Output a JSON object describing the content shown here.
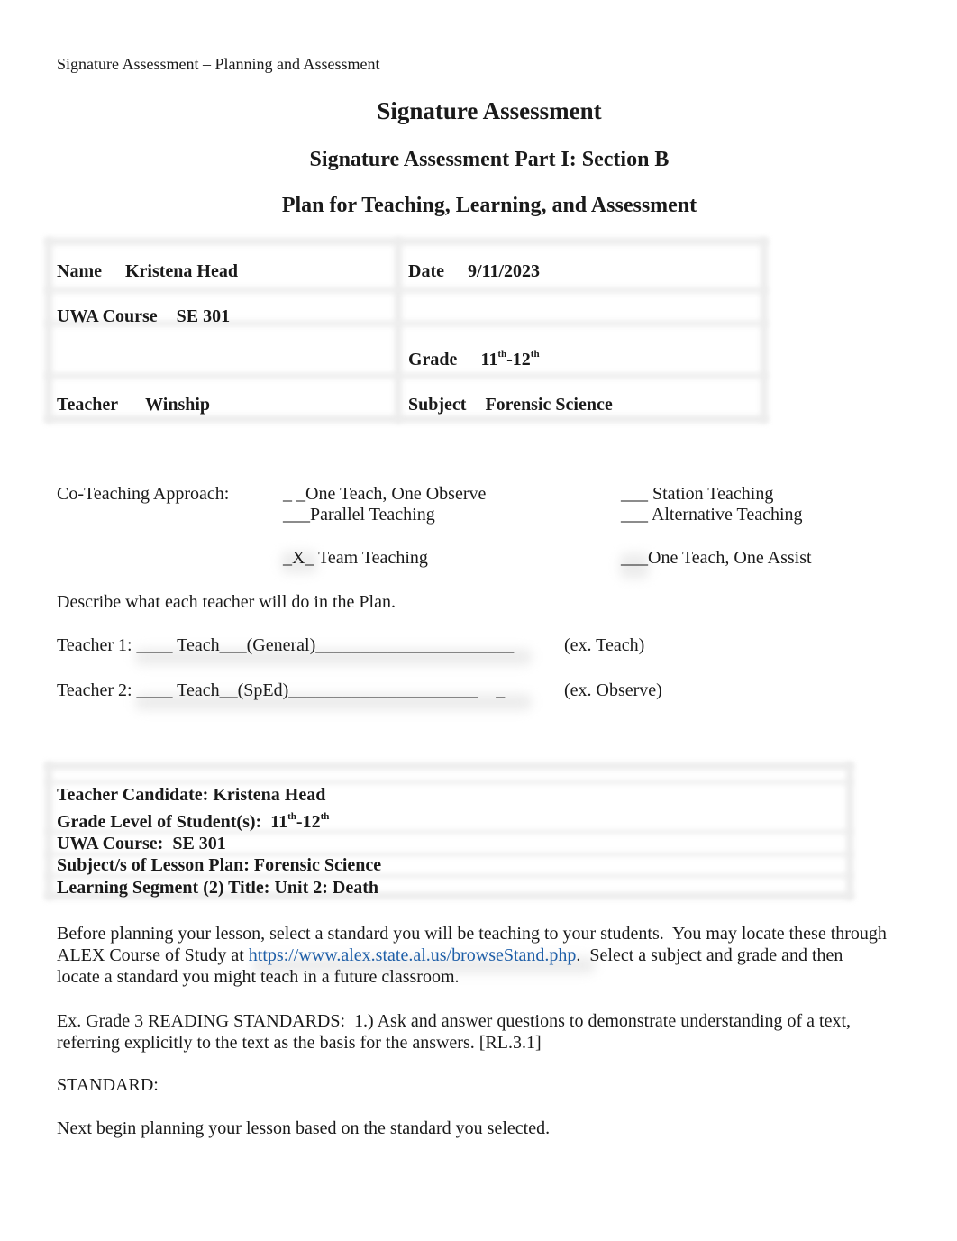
{
  "running_header": "Signature Assessment – Planning and Assessment",
  "titles": {
    "main": "Signature Assessment",
    "part": "Signature Assessment Part I: Section B",
    "plan": "Plan for Teaching, Learning, and Assessment"
  },
  "info_table": {
    "name_label": "Name",
    "name_value": "Kristena Head",
    "date_label": "Date",
    "date_value": "9/11/2023",
    "course_label": "UWA Course",
    "course_value": "SE 301",
    "grade_label": "Grade",
    "grade_from": "11",
    "grade_to": "12",
    "ordinal_suffix": "th",
    "grade_sep": "-",
    "teacher_label": "Teacher",
    "teacher_value": "Winship",
    "subject_label": "Subject",
    "subject_value": "Forensic Science"
  },
  "co_teaching": {
    "label": "Co-Teaching Approach:",
    "options": [
      {
        "mark": "_ _",
        "label": "One Teach, One Observe"
      },
      {
        "mark": "___",
        "label": "Parallel Teaching"
      },
      {
        "mark": "_X_ ",
        "label": "Team Teaching"
      },
      {
        "mark": "___ ",
        "label": "Station Teaching"
      },
      {
        "mark": "___ ",
        "label": "Alternative Teaching"
      },
      {
        "mark": "___",
        "label": "One Teach, One Assist"
      }
    ],
    "selected": "Team Teaching"
  },
  "describe_prompt": "Describe what each teacher will do in the Plan.",
  "teachers": [
    {
      "label": "Teacher 1:",
      "line": "____ Teach___(General)______________________",
      "example": "(ex. Teach)"
    },
    {
      "label": "Teacher 2:",
      "line": "____ Teach__(SpEd)_____________________    _",
      "example": "(ex. Observe)"
    }
  ],
  "candidate_box": {
    "candidate": "Teacher Candidate:  Kristena Head",
    "grade_level_label": "Grade Level of Student(s):  ",
    "grade_from": "11",
    "grade_to": "12",
    "ordinal_suffix": "th",
    "grade_sep": "-",
    "course": "UWA Course:  SE 301",
    "subjects": "Subject/s of Lesson Plan: Forensic Science",
    "segment": "Learning Segment (2) Title: Unit 2: Death"
  },
  "instructions": {
    "line1": "Before planning your lesson, select a standard you will be teaching to your students.  You may locate these through",
    "line2_pre": "ALEX Course of Study at ",
    "link": "https://www.alex.state.al.us/browseStand.php",
    "line2_post": ".  Select a subject and grade and then",
    "line3": "locate a standard you might teach in a future classroom."
  },
  "example_standard": {
    "line1": "Ex. Grade 3 READING STANDARDS:  1.) Ask and answer questions to demonstrate understanding of a text,",
    "line2": "referring explicitly to the text as the basis for the answers. [RL.3.1]"
  },
  "standard_label": "STANDARD:",
  "next_step": "Next begin planning your lesson based on the standard you selected.",
  "colors": {
    "text": "#1a1a1a",
    "link": "#1f5fa8",
    "grid": "#ececec"
  }
}
